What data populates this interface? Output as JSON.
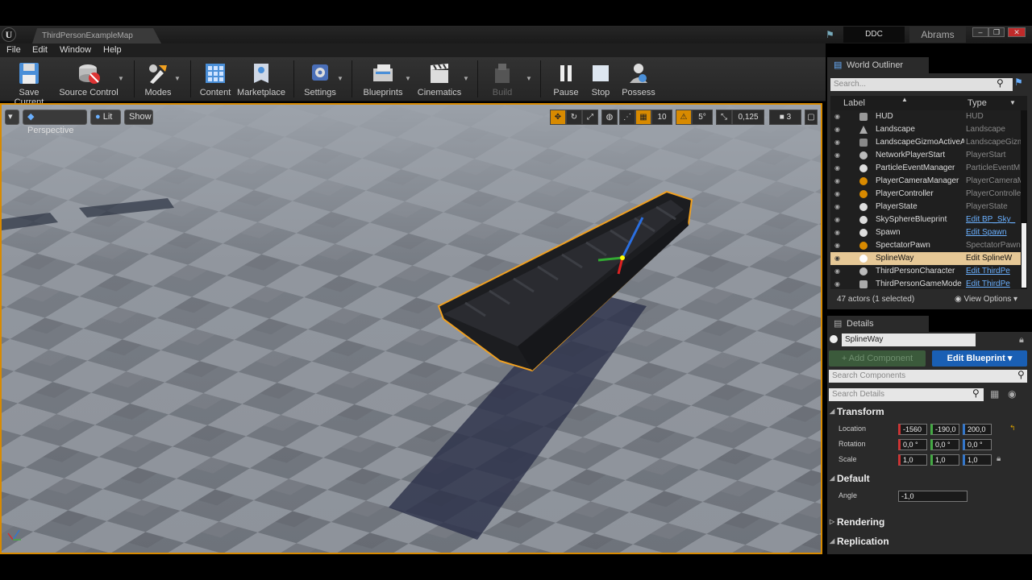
{
  "titlebar": {
    "map_tab": "ThirdPersonExampleMap",
    "ddc": "DDC",
    "user": "Abrams",
    "minimize": "–",
    "restore": "❐",
    "close": "✕"
  },
  "menu": [
    "File",
    "Edit",
    "Window",
    "Help"
  ],
  "toolbar": {
    "save_current": "Save Current",
    "source_control": "Source Control",
    "modes": "Modes",
    "content": "Content",
    "marketplace": "Marketplace",
    "settings": "Settings",
    "blueprints": "Blueprints",
    "cinematics": "Cinematics",
    "build": "Build",
    "pause": "Pause",
    "stop": "Stop",
    "possess": "Possess"
  },
  "viewport": {
    "perspective": "Perspective",
    "lit": "Lit",
    "show": "Show",
    "grid_snap": "10",
    "rotation_snap": "5°",
    "scale_snap": "0,125",
    "camera_speed": "3"
  },
  "outliner": {
    "tab": "World Outliner",
    "search_placeholder": "Search...",
    "col_label": "Label",
    "col_type": "Type",
    "rows": [
      {
        "label": "HUD",
        "type": "HUD"
      },
      {
        "label": "Landscape",
        "type": "Landscape"
      },
      {
        "label": "LandscapeGizmoActiveA",
        "type": "LandscapeGizmo"
      },
      {
        "label": "NetworkPlayerStart",
        "type": "PlayerStart"
      },
      {
        "label": "ParticleEventManager",
        "type": "ParticleEventM"
      },
      {
        "label": "PlayerCameraManager",
        "type": "PlayerCameraM"
      },
      {
        "label": "PlayerController",
        "type": "PlayerController"
      },
      {
        "label": "PlayerState",
        "type": "PlayerState"
      },
      {
        "label": "SkySphereBlueprint",
        "type": "Edit BP_Sky_"
      },
      {
        "label": "Spawn",
        "type": "Edit Spawn"
      },
      {
        "label": "SpectatorPawn",
        "type": "SpectatorPawn"
      },
      {
        "label": "SplineWay",
        "type": "Edit SplineW"
      },
      {
        "label": "ThirdPersonCharacter",
        "type": "Edit ThirdPe"
      },
      {
        "label": "ThirdPersonGameMode",
        "type": "Edit ThirdPe"
      }
    ],
    "footer_count": "47 actors (1 selected)",
    "view_options": "View Options"
  },
  "details": {
    "tab": "Details",
    "actor_name": "SplineWay",
    "add_component": "+ Add Component",
    "edit_blueprint": "Edit Blueprint",
    "search_components": "Search Components",
    "search_details": "Search Details",
    "transform_header": "Transform",
    "location_label": "Location",
    "rotation_label": "Rotation",
    "scale_label": "Scale",
    "location": [
      "-1560",
      "-190,0",
      "200,0"
    ],
    "rotation": [
      "0,0 °",
      "0,0 °",
      "0,0 °"
    ],
    "scale": [
      "1,0",
      "1,0",
      "1,0"
    ],
    "default_header": "Default",
    "angle_label": "Angle",
    "angle_value": "-1,0",
    "rendering_header": "Rendering",
    "replication_header": "Replication"
  },
  "colors": {
    "selection": "#d88a00",
    "accent_blue": "#1a5fb4",
    "row_selected": "#e6c896"
  }
}
